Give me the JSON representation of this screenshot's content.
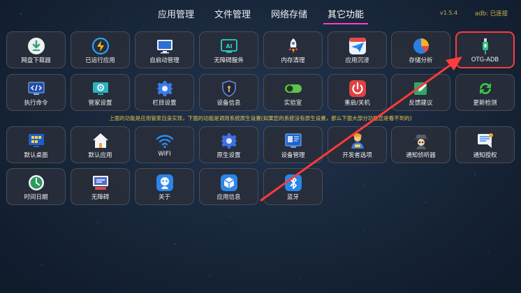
{
  "tabs": [
    "应用管理",
    "文件管理",
    "网络存储",
    "其它功能"
  ],
  "active_tab": "其它功能",
  "version": "v1.5.4",
  "adb_status": "adb: 已连接",
  "notice": "上面的功能是应用管家自身实现，下面的功能是调用系统原生设置(如果您的系统没有原生设置，那么下面大部分功能您是看不到的)",
  "colors": {
    "accent": "#ff3ec8",
    "highlight": "#ff3b3b",
    "notice": "#e6c84a"
  },
  "row1": [
    {
      "label": "网盘下载器",
      "icon": "download-icon"
    },
    {
      "label": "已运行应用",
      "icon": "lightning-icon"
    },
    {
      "label": "自启动管理",
      "icon": "monitor-icon"
    },
    {
      "label": "无障碍服务",
      "icon": "ai-screen-icon"
    },
    {
      "label": "内存清理",
      "icon": "rocket-icon"
    },
    {
      "label": "应用沉浸",
      "icon": "paper-plane-icon"
    },
    {
      "label": "存储分析",
      "icon": "pie-chart-icon"
    },
    {
      "label": "OTG-ADB",
      "icon": "usb-cable-icon"
    }
  ],
  "row2": [
    {
      "label": "执行命令",
      "icon": "code-screen-icon"
    },
    {
      "label": "管家设置",
      "icon": "settings-screen-icon"
    },
    {
      "label": "栏目设置",
      "icon": "gear-icon"
    },
    {
      "label": "设备信息",
      "icon": "shield-icon"
    },
    {
      "label": "实验室",
      "icon": "toggle-icon"
    },
    {
      "label": "重启/关机",
      "icon": "power-icon"
    },
    {
      "label": "反馈建议",
      "icon": "edit-icon"
    },
    {
      "label": "更新检测",
      "icon": "refresh-icon"
    }
  ],
  "row3": [
    {
      "label": "默认桌面",
      "icon": "desktop-grid-icon"
    },
    {
      "label": "默认应用",
      "icon": "home-icon"
    },
    {
      "label": "WIFI",
      "icon": "wifi-icon"
    },
    {
      "label": "原生设置",
      "icon": "gear-icon"
    },
    {
      "label": "设备管理",
      "icon": "device-screen-icon"
    },
    {
      "label": "开发者选项",
      "icon": "developer-icon"
    },
    {
      "label": "通知侦听器",
      "icon": "detective-icon"
    },
    {
      "label": "通知授权",
      "icon": "message-icon"
    }
  ],
  "row4": [
    {
      "label": "时间日期",
      "icon": "clock-icon"
    },
    {
      "label": "无障碍",
      "icon": "accessibility-icon"
    },
    {
      "label": "关于",
      "icon": "robot-icon"
    },
    {
      "label": "应用信息",
      "icon": "box-icon"
    },
    {
      "label": "蓝牙",
      "icon": "bluetooth-icon"
    }
  ]
}
